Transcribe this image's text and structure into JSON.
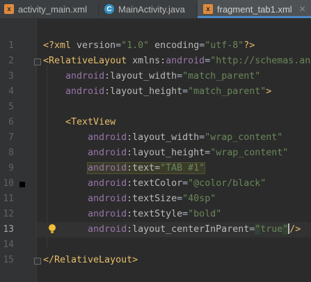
{
  "tabs": [
    {
      "label": "activity_main.xml",
      "icon": "xml-file-icon",
      "active": false
    },
    {
      "label": "MainActivity.java",
      "icon": "java-class-icon",
      "active": false
    },
    {
      "label": "fragment_tab1.xml",
      "icon": "xml-file-icon",
      "active": true
    }
  ],
  "editor": {
    "line_numbers": [
      "1",
      "2",
      "3",
      "4",
      "5",
      "6",
      "7",
      "8",
      "9",
      "10",
      "11",
      "12",
      "13",
      "14",
      "15"
    ],
    "current_line": "13",
    "code": {
      "l1": {
        "a": "<?xml ",
        "b": "version",
        "c": "=",
        "d": "\"1.0\"",
        "e": " ",
        "f": "encoding",
        "g": "=",
        "h": "\"utf-8\"",
        "i": "?>"
      },
      "l2": {
        "a": "<RelativeLayout ",
        "b": "xmlns:",
        "c": "android",
        "d": "=",
        "e": "\"http://schemas.android.com/apk/res/android\""
      },
      "l3": {
        "a": "android",
        "b": ":layout_width",
        "c": "=",
        "d": "\"match_parent\""
      },
      "l4": {
        "a": "android",
        "b": ":layout_height",
        "c": "=",
        "d": "\"match_parent\"",
        "e": ">"
      },
      "l6": {
        "a": "<TextView"
      },
      "l7": {
        "a": "android",
        "b": ":layout_width",
        "c": "=",
        "d": "\"wrap_content\""
      },
      "l8": {
        "a": "android",
        "b": ":layout_height",
        "c": "=",
        "d": "\"wrap_content\""
      },
      "l9": {
        "a": "android",
        "b": ":text",
        "c": "=",
        "d": "\"TAB #1\""
      },
      "l10": {
        "a": "android",
        "b": ":textColor",
        "c": "=",
        "d": "\"@color/black\""
      },
      "l11": {
        "a": "android",
        "b": ":textSize",
        "c": "=",
        "d": "\"40sp\""
      },
      "l12": {
        "a": "android",
        "b": ":textStyle",
        "c": "=",
        "d": "\"bold\""
      },
      "l13": {
        "a": "android",
        "b": ":layout_centerInParent",
        "c": "=",
        "d1": "\"",
        "d2": "true",
        "d3": "\"",
        "e": "/>"
      },
      "l15": {
        "a": "</RelativeLayout>"
      }
    }
  },
  "colors": {
    "background": "#2b2b2b",
    "tag": "#e8bf6a",
    "namespace": "#9876aa",
    "string": "#6a8759",
    "tab_underline": "#4a88c7"
  }
}
